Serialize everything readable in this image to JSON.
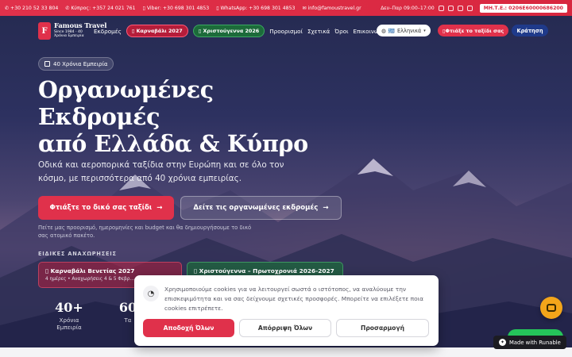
{
  "topbar": {
    "phone": "+30 210 52 33 804",
    "cyprus": "Κύπρος: +357 24 021 761",
    "viber": "Viber: +30 698 301 4853",
    "whatsapp": "WhatsApp: +30 698 301 4853",
    "email": "info@famoustravel.gr",
    "hours": "Δευ–Παρ 09:00–17:00",
    "gemi": "ΜΗ.Τ.Ε.: 0206Ε60000686200"
  },
  "logo": {
    "letter": "F",
    "name": "Famous Travel",
    "since": "Since 1984 · 40",
    "tag": "Χρόνια Εμπειρία"
  },
  "nav": {
    "excursions": "Εκδρομές",
    "carnival": "Καρναβάλι 2027",
    "christmas": "Χριστούγεννα 2026",
    "destinations": "Προορισμοί",
    "about": "Σχετικά",
    "terms": "Όροι",
    "contact": "Επικοινωνία",
    "language": "Ελληνικά",
    "flag": "🇬🇷",
    "design_trip": "Φτιάξε το ταξίδι σας",
    "book": "Κράτηση"
  },
  "hero": {
    "badge": "40 Χρόνια Εμπειρία",
    "title_line1": "Οργανωμένες",
    "title_line2": "Εκδρομές",
    "title_line3": "από Ελλάδα & Κύπρο",
    "subtitle": "Οδικά και αεροπορικά ταξίδια στην Ευρώπη και σε όλο τον κόσμο, με περισσότερα από 40 χρόνια εμπειρίας.",
    "cta_primary": "Φτιάξτε το δικό σας ταξίδι",
    "cta_secondary": "Δείτε τις οργανωμένες εκδρομές",
    "note": "Πείτε μας προορισμό, ημερομηνίες και budget και θα δημιουργήσουμε το δικό σας ατομικό πακέτο.",
    "special_label": "ΕΙΔΙΚΕΣ ΑΝΑΧΩΡΗΣΕΙΣ"
  },
  "offers": [
    {
      "title": "Καρναβάλι Βενετίας 2027",
      "detail": "4 ημέρες • Αναχωρήσεις 4 & 5 Φεβρ..."
    },
    {
      "title": "Χριστούγεννα – Πρωτοχρονιά 2026-2027",
      "detail": ""
    }
  ],
  "stats": [
    {
      "number": "40+",
      "label": "Χρόνια Εμπειρία"
    },
    {
      "number": "60",
      "label": "Τα"
    }
  ],
  "cookie": {
    "text": "Χρησιμοποιούμε cookies για να λειτουργεί σωστά ο ιστότοπος, να αναλύουμε την επισκεψιμότητα και να σας δείχνουμε σχετικές προσφορές. Μπορείτε να επιλέξετε ποια cookies επιτρέπετε.",
    "accept": "Αποδοχή Όλων",
    "reject": "Απόρριψη Όλων",
    "customize": "Προσαρμογή"
  },
  "widgets": {
    "runable": "Made with Runable"
  },
  "icons": {
    "phone": "phone-icon",
    "mail": "mail-icon",
    "shield": "shield-icon",
    "cookie": "cookie-icon",
    "arrow": "arrow-right-icon",
    "bot": "bot-icon"
  },
  "colors": {
    "accent": "#e0314b",
    "green": "#1c6b3a",
    "navy": "#1f3a8a",
    "bot": "#f3a51a"
  }
}
